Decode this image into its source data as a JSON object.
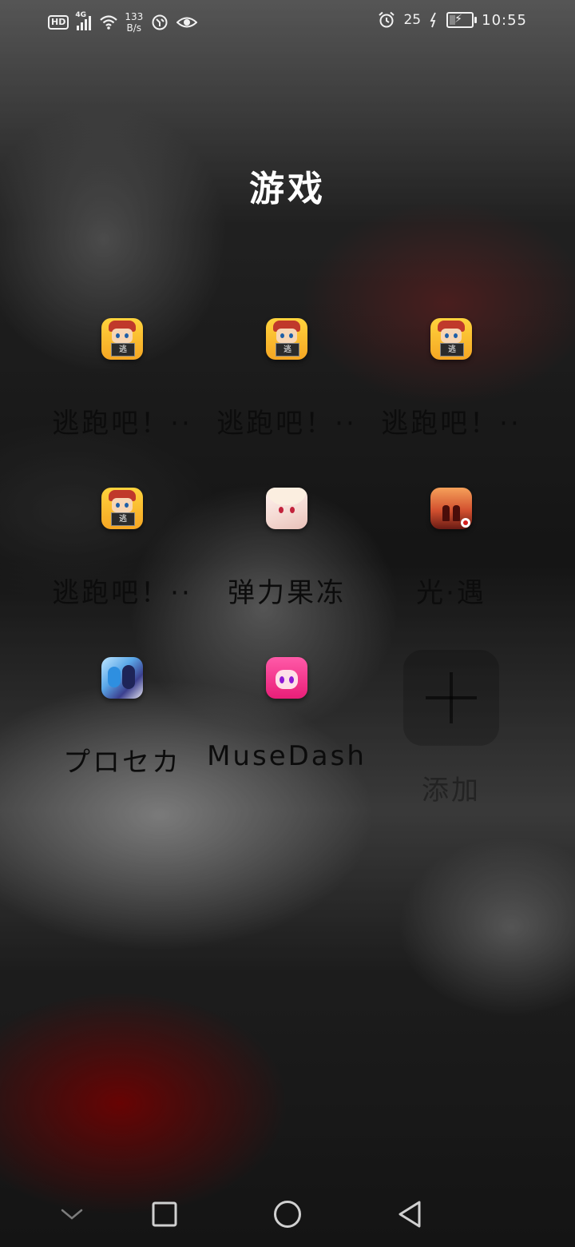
{
  "status_bar": {
    "hd_label": "HD",
    "network_type": "4G",
    "net_speed_value": "133",
    "net_speed_unit": "B/s",
    "battery_label": "25",
    "time": "10:55",
    "icons": [
      "hd-icon",
      "signal-icon",
      "wifi-icon",
      "data-saver-icon",
      "eye-comfort-icon",
      "alarm-icon",
      "charging-icon",
      "battery-icon"
    ]
  },
  "folder": {
    "title": "游戏",
    "apps": [
      {
        "label": "逃跑吧！··",
        "icon": "escape-game-icon",
        "badge": "逃"
      },
      {
        "label": "逃跑吧！··",
        "icon": "escape-game-icon",
        "badge": "逃"
      },
      {
        "label": "逃跑吧！··",
        "icon": "escape-game-icon",
        "badge": "逃"
      },
      {
        "label": "逃跑吧！··",
        "icon": "escape-game-icon",
        "badge": "逃"
      },
      {
        "label": "弹力果冻",
        "icon": "bounce-jelly-icon"
      },
      {
        "label": "光·遇",
        "icon": "sky-game-icon"
      },
      {
        "label": "プロセカ",
        "icon": "project-sekai-icon"
      },
      {
        "label": "MuseDash",
        "icon": "muse-dash-icon"
      }
    ],
    "add_label": "添加"
  },
  "colors": {
    "title": "#ffffff",
    "label": "#0c0c0c",
    "status_text": "#f2f2f2"
  },
  "nav_bar": {
    "icons": [
      "collapse-chevron-icon",
      "recents-square-icon",
      "home-circle-icon",
      "back-triangle-icon"
    ]
  }
}
